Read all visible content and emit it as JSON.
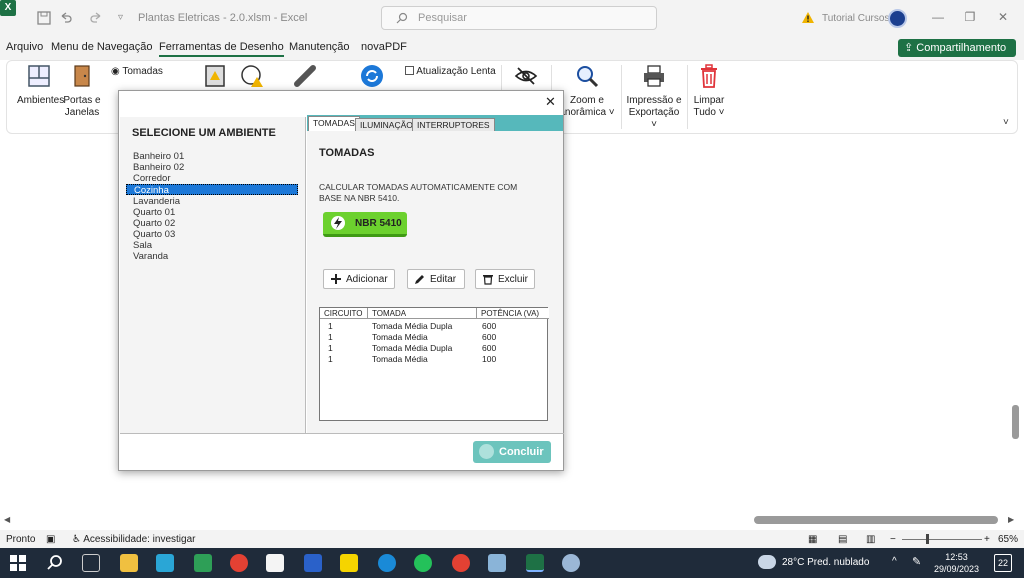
{
  "titlebar": {
    "doc_title": "Plantas Eletricas - 2.0.xlsm  -  Excel",
    "search_placeholder": "Pesquisar",
    "account_name": "Tutorial Cursos"
  },
  "menu": {
    "tabs": [
      "Arquivo",
      "Menu de Navegação",
      "Ferramentas de Desenho",
      "Manutenção",
      "novaPDF"
    ],
    "active": "Ferramentas de Desenho",
    "share_label": "Compartilhamento"
  },
  "ribbon": {
    "ambientes": "Ambientes",
    "portas_1": "Portas e",
    "portas_2": "Janelas",
    "tomadas": "Tomadas",
    "atualizacao": "Atualização Lenta",
    "zoom_1": "Zoom e",
    "zoom_2": "anorâmica ˅",
    "impressao_1": "Impressão e",
    "impressao_2": "Exportação ˅",
    "limpar_1": "Limpar",
    "limpar_2": "Tudo ˅"
  },
  "dialog": {
    "left_header": "SELECIONE UM AMBIENTE",
    "ambientes": [
      "Banheiro 01",
      "Banheiro 02",
      "Corredor",
      "Cozinha",
      "Lavanderia",
      "Quarto 01",
      "Quarto 02",
      "Quarto 03",
      "Sala",
      "Varanda"
    ],
    "selected_ambiente": "Cozinha",
    "tabs": [
      "TOMADAS",
      "ILUMINAÇÃO",
      "INTERRUPTORES"
    ],
    "active_tab": "TOMADAS",
    "panel_title": "TOMADAS",
    "description": "CALCULAR TOMADAS AUTOMATICAMENTE COM BASE NA NBR 5410.",
    "nbr_button": "NBR 5410",
    "add_button": "Adicionar",
    "edit_button": "Editar",
    "delete_button": "Excluir",
    "table": {
      "headers": [
        "CIRCUITO",
        "TOMADA",
        "POTÊNCIA (VA)"
      ],
      "rows": [
        [
          "1",
          "Tomada Média Dupla",
          "600"
        ],
        [
          "1",
          "Tomada Média",
          "600"
        ],
        [
          "1",
          "Tomada Média Dupla",
          "600"
        ],
        [
          "1",
          "Tomada Média",
          "100"
        ]
      ]
    },
    "conclude_button": "Concluir"
  },
  "status": {
    "ready": "Pronto",
    "accessibility": "Acessibilidade: investigar",
    "zoom": "65%"
  },
  "taskbar": {
    "weather": "28°C  Pred. nublado",
    "time": "12:53",
    "date": "29/09/2023",
    "notif_count": "22"
  },
  "colors": {
    "excel_green": "#1e7145",
    "dialog_tab_bar": "#56b8bb",
    "nbr_green": "#6cd12e",
    "selection_blue": "#1c78d8",
    "conclude_teal": "#6cc4bd"
  }
}
